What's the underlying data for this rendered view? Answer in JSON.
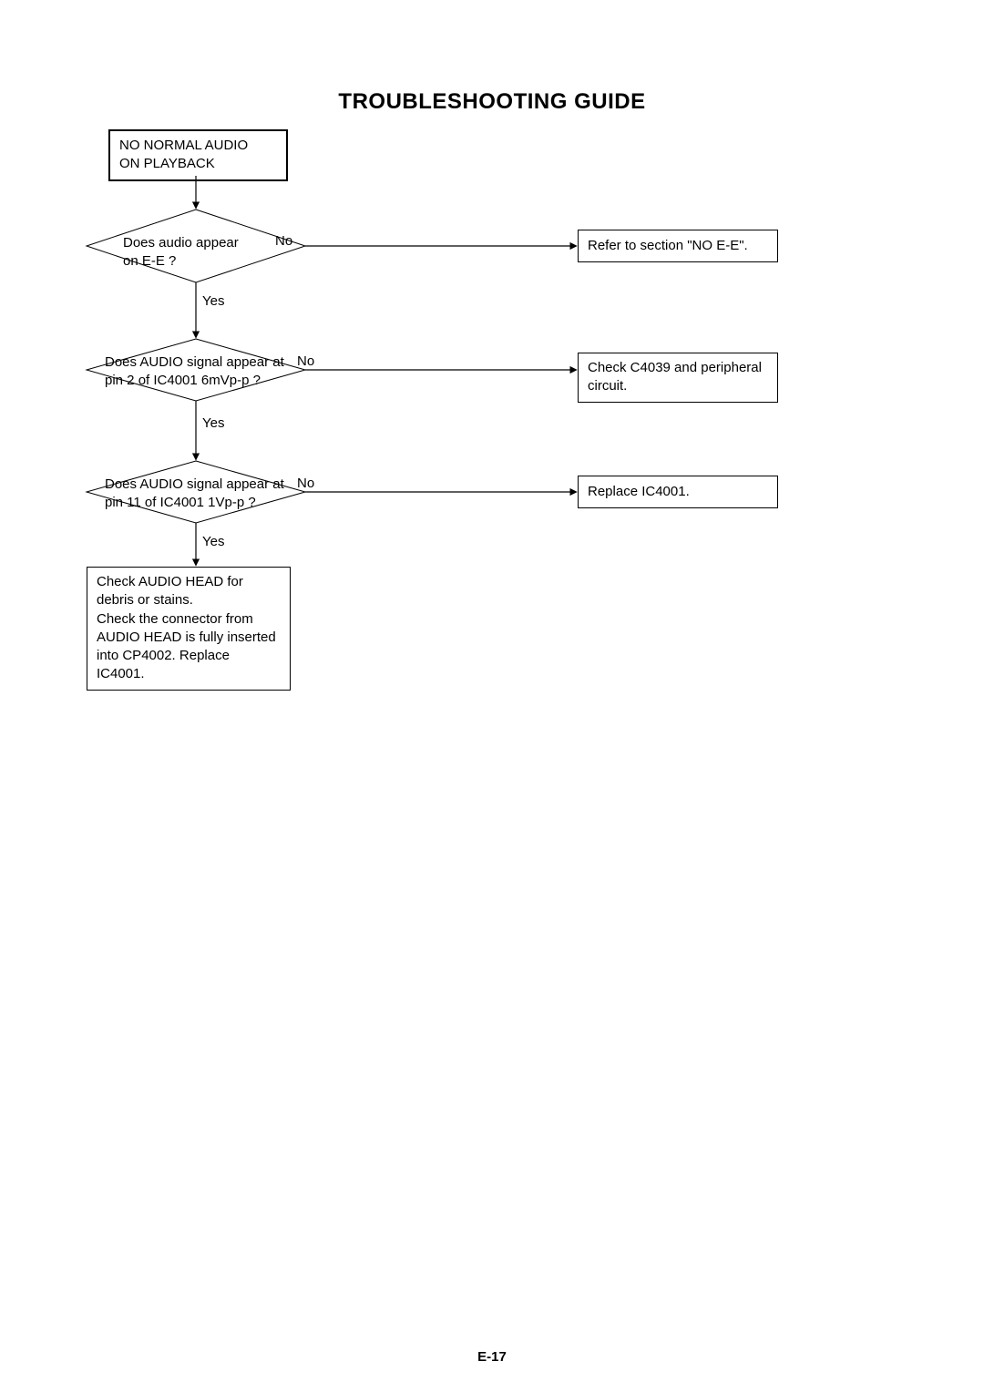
{
  "title": "TROUBLESHOOTING GUIDE",
  "page_number": "E-17",
  "start": "NO NORMAL AUDIO\nON PLAYBACK",
  "d1": {
    "line1": "Does audio appear",
    "line2": "on E-E ?"
  },
  "d2": {
    "line1": "Does AUDIO signal appear at",
    "line2": "pin 2 of IC4001 6mVp-p ?"
  },
  "d3": {
    "line1": "Does AUDIO signal appear at",
    "line2": "pin 11 of IC4001 1Vp-p ?"
  },
  "a1": "Refer to section \"NO E-E\".",
  "a2": "Check C4039 and peripheral\ncircuit.",
  "a3": "Replace IC4001.",
  "final": "Check AUDIO HEAD for\ndebris or stains.\nCheck the connector from\nAUDIO HEAD is fully inserted\ninto CP4002. Replace IC4001.",
  "labels": {
    "yes": "Yes",
    "no": "No"
  }
}
